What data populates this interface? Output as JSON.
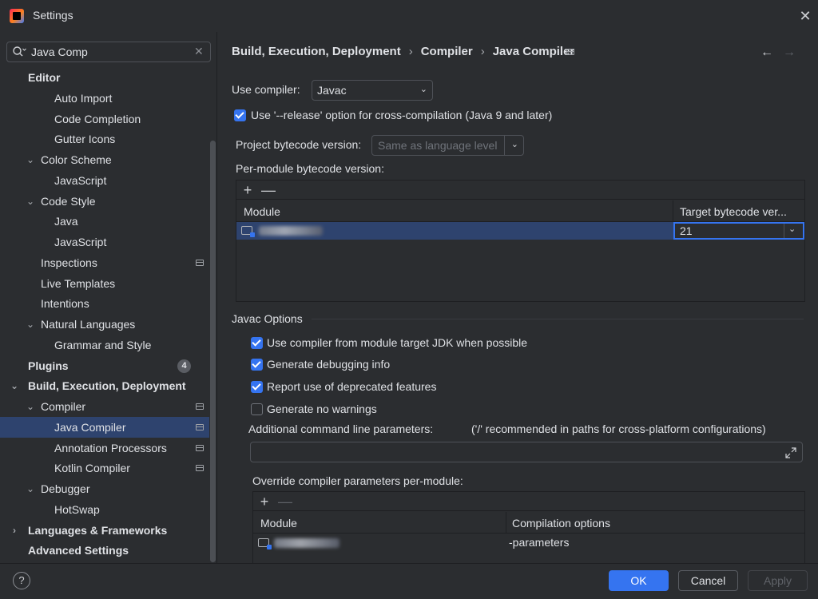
{
  "window": {
    "title": "Settings",
    "close_glyph": "✕"
  },
  "search": {
    "value": "Java Comp",
    "clear_glyph": "✕"
  },
  "sidebar": {
    "items": [
      {
        "label": "Editor",
        "level": 0,
        "bold": true,
        "chevron": "",
        "pinned": false
      },
      {
        "label": "Auto Import",
        "level": 2,
        "bold": false,
        "chevron": "",
        "pinned": false
      },
      {
        "label": "Code Completion",
        "level": 2,
        "bold": false,
        "chevron": "",
        "pinned": false
      },
      {
        "label": "Gutter Icons",
        "level": 2,
        "bold": false,
        "chevron": "",
        "pinned": false
      },
      {
        "label": "Color Scheme",
        "level": 1,
        "bold": false,
        "chevron": "⌄",
        "pinned": false
      },
      {
        "label": "JavaScript",
        "level": 2,
        "bold": false,
        "chevron": "",
        "pinned": false
      },
      {
        "label": "Code Style",
        "level": 1,
        "bold": false,
        "chevron": "⌄",
        "pinned": false
      },
      {
        "label": "Java",
        "level": 2,
        "bold": false,
        "chevron": "",
        "pinned": false
      },
      {
        "label": "JavaScript",
        "level": 2,
        "bold": false,
        "chevron": "",
        "pinned": false
      },
      {
        "label": "Inspections",
        "level": 1,
        "bold": false,
        "chevron": "",
        "pinned": true
      },
      {
        "label": "Live Templates",
        "level": 1,
        "bold": false,
        "chevron": "",
        "pinned": false
      },
      {
        "label": "Intentions",
        "level": 1,
        "bold": false,
        "chevron": "",
        "pinned": false
      },
      {
        "label": "Natural Languages",
        "level": 1,
        "bold": false,
        "chevron": "⌄",
        "pinned": false
      },
      {
        "label": "Grammar and Style",
        "level": 2,
        "bold": false,
        "chevron": "",
        "pinned": false
      },
      {
        "label": "Plugins",
        "level": 0,
        "bold": true,
        "chevron": "",
        "pinned": false,
        "badge": "4"
      },
      {
        "label": "Build, Execution, Deployment",
        "level": 0,
        "bold": true,
        "chevron": "⌄",
        "pinned": false
      },
      {
        "label": "Compiler",
        "level": 1,
        "bold": false,
        "chevron": "⌄",
        "pinned": true
      },
      {
        "label": "Java Compiler",
        "level": 2,
        "bold": false,
        "chevron": "",
        "pinned": true,
        "selected": true
      },
      {
        "label": "Annotation Processors",
        "level": 2,
        "bold": false,
        "chevron": "",
        "pinned": true
      },
      {
        "label": "Kotlin Compiler",
        "level": 2,
        "bold": false,
        "chevron": "",
        "pinned": true
      },
      {
        "label": "Debugger",
        "level": 1,
        "bold": false,
        "chevron": "⌄",
        "pinned": false
      },
      {
        "label": "HotSwap",
        "level": 2,
        "bold": false,
        "chevron": "",
        "pinned": false
      },
      {
        "label": "Languages & Frameworks",
        "level": 0,
        "bold": true,
        "chevron": "›",
        "pinned": false
      },
      {
        "label": "Advanced Settings",
        "level": 0,
        "bold": true,
        "chevron": "",
        "pinned": false
      }
    ]
  },
  "breadcrumb": {
    "parts": [
      "Build, Execution, Deployment",
      "Compiler",
      "Java Compiler"
    ],
    "sep": "›"
  },
  "nav": {
    "back": "←",
    "forward": "→"
  },
  "compiler": {
    "use_compiler_label": "Use compiler:",
    "use_compiler_value": "Javac",
    "release_option_label": "Use '--release' option for cross-compilation (Java 9 and later)",
    "release_option_checked": true,
    "project_bytecode_label": "Project bytecode version:",
    "project_bytecode_value": "Same as language level",
    "per_module_label": "Per-module bytecode version:",
    "module_table": {
      "add": "+",
      "remove": "—",
      "headers": [
        "Module",
        "Target bytecode ver..."
      ],
      "rows": [
        {
          "target": "21"
        }
      ]
    }
  },
  "javac": {
    "section_title": "Javac Options",
    "options": [
      {
        "label": "Use compiler from module target JDK when possible",
        "checked": true
      },
      {
        "label": "Generate debugging info",
        "checked": true
      },
      {
        "label": "Report use of deprecated features",
        "checked": true
      },
      {
        "label": "Generate no warnings",
        "checked": false
      }
    ],
    "cmd_params_label": "Additional command line parameters:",
    "cmd_params_hint": "('/' recommended in paths for cross-platform configurations)",
    "cmd_params_value": "",
    "override_label": "Override compiler parameters per-module:",
    "override_table": {
      "add": "+",
      "remove": "—",
      "headers": [
        "Module",
        "Compilation options"
      ],
      "rows": [
        {
          "options": "-parameters"
        }
      ]
    }
  },
  "footer": {
    "help": "?",
    "ok": "OK",
    "cancel": "Cancel",
    "apply": "Apply"
  }
}
